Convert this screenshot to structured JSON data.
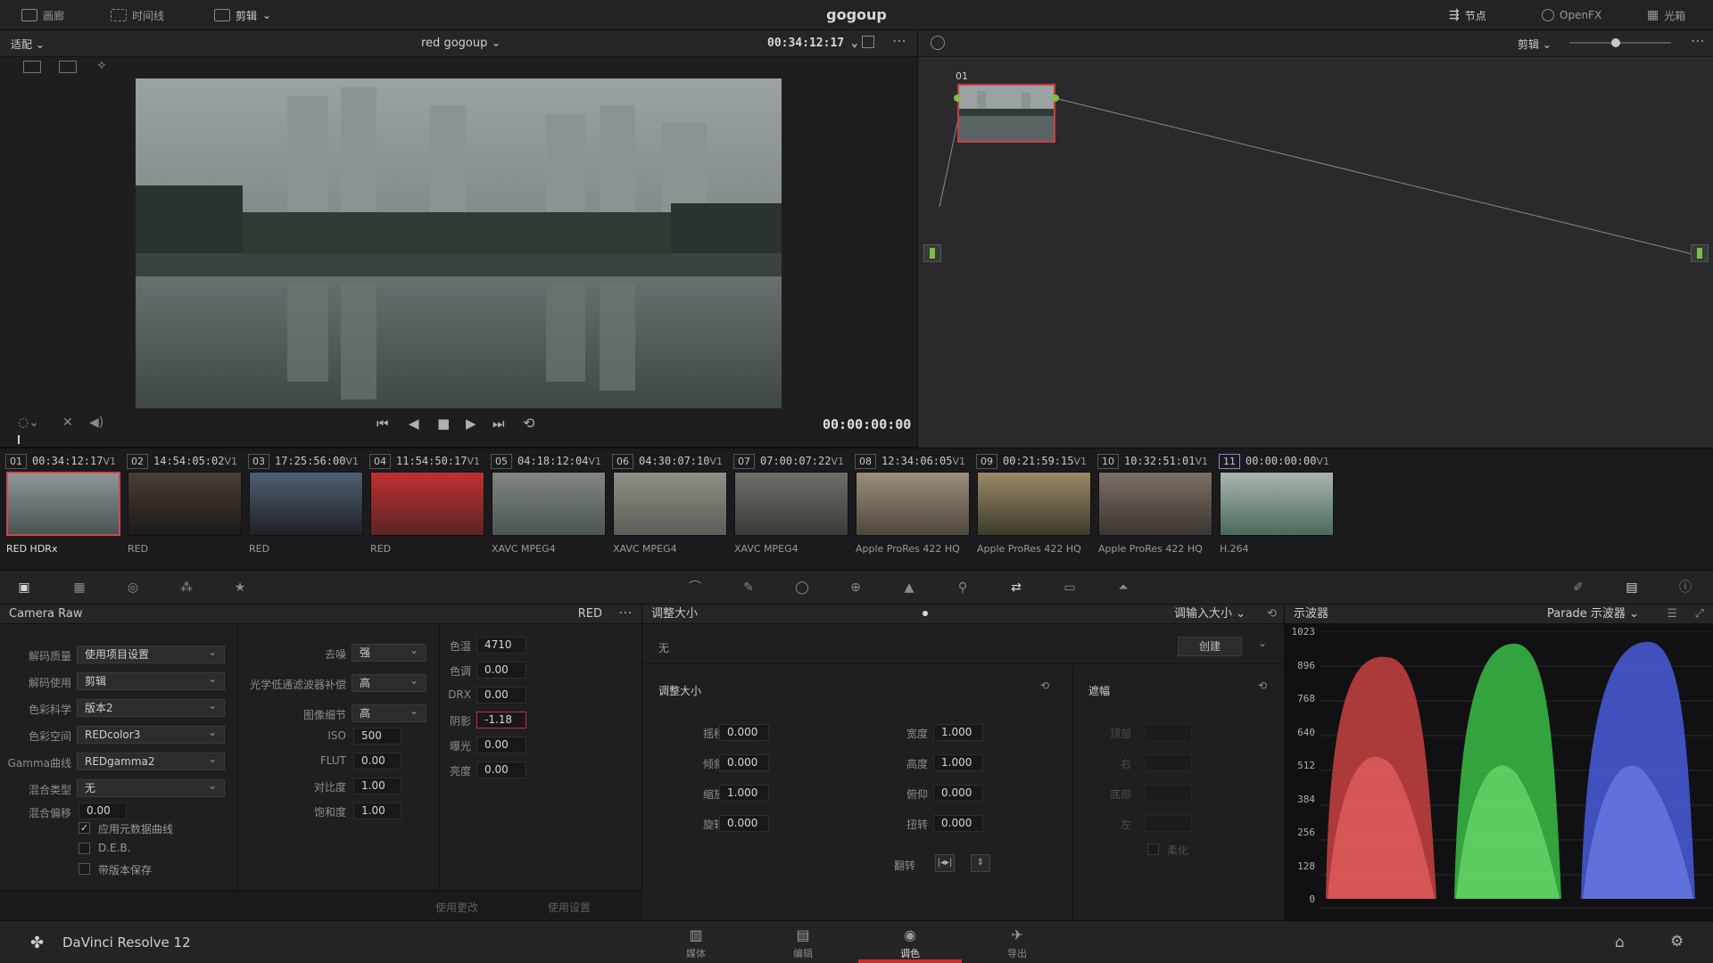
{
  "app": {
    "project_title": "gogoup",
    "product_name": "DaVinci Resolve 12"
  },
  "topbar": {
    "left": [
      {
        "label": "画廊",
        "icon": "gallery-icon"
      },
      {
        "label": "时间线",
        "icon": "timeline-icon"
      },
      {
        "label": "剪辑",
        "icon": "clips-icon"
      }
    ],
    "right": [
      {
        "label": "节点",
        "icon": "nodes-icon"
      },
      {
        "label": "OpenFX",
        "icon": "openfx-icon"
      },
      {
        "label": "光箱",
        "icon": "lightbox-icon"
      }
    ]
  },
  "viewer": {
    "fit_label": "适配",
    "timeline_name": "red gogoup",
    "timecode": "00:34:12:17",
    "playhead_timecode": "00:00:00:00"
  },
  "node_editor": {
    "mode_label": "剪辑",
    "node_label": "01",
    "zoom_level": 0.45
  },
  "clips": [
    {
      "num": "01",
      "tc": "00:34:12:17",
      "track": "V1",
      "codec": "RED HDRx",
      "active": true
    },
    {
      "num": "02",
      "tc": "14:54:05:02",
      "track": "V1",
      "codec": "RED"
    },
    {
      "num": "03",
      "tc": "17:25:56:00",
      "track": "V1",
      "codec": "RED"
    },
    {
      "num": "04",
      "tc": "11:54:50:17",
      "track": "V1",
      "codec": "RED"
    },
    {
      "num": "05",
      "tc": "04:18:12:04",
      "track": "V1",
      "codec": "XAVC MPEG4"
    },
    {
      "num": "06",
      "tc": "04:30:07:10",
      "track": "V1",
      "codec": "XAVC MPEG4"
    },
    {
      "num": "07",
      "tc": "07:00:07:22",
      "track": "V1",
      "codec": "XAVC MPEG4"
    },
    {
      "num": "08",
      "tc": "12:34:06:05",
      "track": "V1",
      "codec": "Apple ProRes 422 HQ"
    },
    {
      "num": "09",
      "tc": "00:21:59:15",
      "track": "V1",
      "codec": "Apple ProRes 422 HQ"
    },
    {
      "num": "10",
      "tc": "10:32:51:01",
      "track": "V1",
      "codec": "Apple ProRes 422 HQ"
    },
    {
      "num": "11",
      "tc": "00:00:00:00",
      "track": "V1",
      "codec": "H.264"
    }
  ],
  "camera_raw": {
    "title": "Camera Raw",
    "format": "RED",
    "left_fields": [
      {
        "label": "解码质量",
        "value": "使用项目设置"
      },
      {
        "label": "解码使用",
        "value": "剪辑"
      },
      {
        "label": "色彩科学",
        "value": "版本2"
      },
      {
        "label": "色彩空间",
        "value": "REDcolor3"
      },
      {
        "label": "Gamma曲线",
        "value": "REDgamma2"
      },
      {
        "label": "混合类型",
        "value": "无"
      }
    ],
    "mix_offset": {
      "label": "混合偏移",
      "value": "0.00"
    },
    "checkboxes": [
      {
        "label": "应用元数据曲线",
        "checked": true
      },
      {
        "label": "D.E.B.",
        "checked": false
      },
      {
        "label": "带版本保存",
        "checked": false
      }
    ],
    "mid_selects": [
      {
        "label": "去噪",
        "value": "强"
      },
      {
        "label": "光学低通滤波器补偿",
        "value": "高"
      },
      {
        "label": "图像细节",
        "value": "高"
      }
    ],
    "mid_fields": [
      {
        "label": "ISO",
        "value": "500"
      },
      {
        "label": "FLUT",
        "value": "0.00"
      },
      {
        "label": "对比度",
        "value": "1.00"
      },
      {
        "label": "饱和度",
        "value": "1.00"
      }
    ],
    "right_fields": [
      {
        "label": "色温",
        "value": "4710"
      },
      {
        "label": "色调",
        "value": "0.00"
      },
      {
        "label": "DRX",
        "value": "0.00"
      },
      {
        "label": "阴影",
        "value": "-1.18",
        "highlight": true
      },
      {
        "label": "曝光",
        "value": "0.00"
      },
      {
        "label": "亮度",
        "value": "0.00"
      }
    ],
    "footer": {
      "apply_changes": "使用更改",
      "use_settings": "使用设置"
    }
  },
  "sizing": {
    "title": "调整大小",
    "mode": "调输入大小",
    "preset": "无",
    "create_button": "创建",
    "section_title": "调整大小",
    "left": [
      {
        "label": "摇移",
        "value": "0.000"
      },
      {
        "label": "倾斜",
        "value": "0.000"
      },
      {
        "label": "缩放",
        "value": "1.000"
      },
      {
        "label": "旋转",
        "value": "0.000"
      }
    ],
    "right": [
      {
        "label": "宽度",
        "value": "1.000"
      },
      {
        "label": "高度",
        "value": "1.000"
      },
      {
        "label": "俯仰",
        "value": "0.000"
      },
      {
        "label": "扭转",
        "value": "0.000"
      }
    ],
    "flip_label": "翻转",
    "mask": {
      "title": "遮幅",
      "fields": [
        "顶部",
        "右",
        "底部",
        "左"
      ],
      "soft_label": "柔化"
    }
  },
  "scope": {
    "title": "示波器",
    "mode": "Parade 示波器",
    "ticks": [
      "1023",
      "896",
      "768",
      "640",
      "512",
      "384",
      "256",
      "128",
      "0"
    ]
  },
  "bottom_nav": [
    {
      "label": "媒体",
      "icon": "media-icon"
    },
    {
      "label": "编辑",
      "icon": "edit-icon"
    },
    {
      "label": "调色",
      "icon": "color-icon",
      "active": true
    },
    {
      "label": "导出",
      "icon": "deliver-icon"
    }
  ],
  "colors": {
    "accent": "#c9302c",
    "selected_clip_border": "#d04848",
    "node_green": "#7bc043"
  }
}
